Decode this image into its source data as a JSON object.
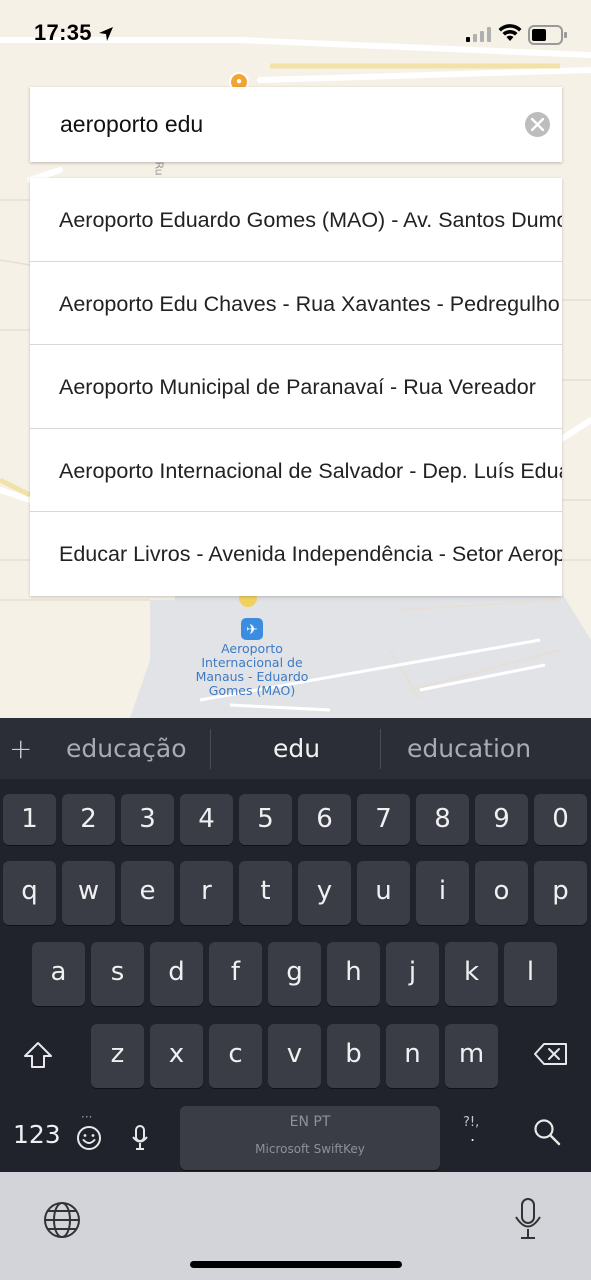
{
  "status_bar": {
    "time": "17:35"
  },
  "search": {
    "value": "aeroporto edu"
  },
  "suggestions": [
    {
      "label": "Aeroporto Eduardo Gomes (MAO) - Av. Santos Dumont"
    },
    {
      "label": "Aeroporto Edu Chaves - Rua Xavantes - Pedregulho"
    },
    {
      "label": "Aeroporto Municipal de Paranavaí - Rua Vereador"
    },
    {
      "label": "Aeroporto Internacional de Salvador - Dep. Luís Eduardo"
    },
    {
      "label": "Educar Livros - Avenida Independência - Setor Aeroporto"
    }
  ],
  "map": {
    "airport_label_lines": [
      "Aeroporto",
      "Internacional de",
      "Manaus - Eduardo",
      "Gomes (MAO)"
    ],
    "street_label": "Ru"
  },
  "keyboard": {
    "predictions": [
      "educação",
      "edu",
      "education"
    ],
    "plus": "+",
    "numbers": [
      "1",
      "2",
      "3",
      "4",
      "5",
      "6",
      "7",
      "8",
      "9",
      "0"
    ],
    "row1": [
      "q",
      "w",
      "e",
      "r",
      "t",
      "y",
      "u",
      "i",
      "o",
      "p"
    ],
    "row2": [
      "a",
      "s",
      "d",
      "f",
      "g",
      "h",
      "j",
      "k",
      "l"
    ],
    "row3": [
      "z",
      "x",
      "c",
      "v",
      "b",
      "n",
      "m"
    ],
    "numeric_switch": "123",
    "space_lang": "EN PT",
    "space_brand": "Microsoft SwiftKey",
    "punct": "?!,",
    "punct_dot": ".",
    "emoji_dots": "···"
  },
  "colors": {
    "accent": "#3b8de0",
    "keyboard_bg": "#20232b",
    "key_bg": "#3a3d46"
  }
}
